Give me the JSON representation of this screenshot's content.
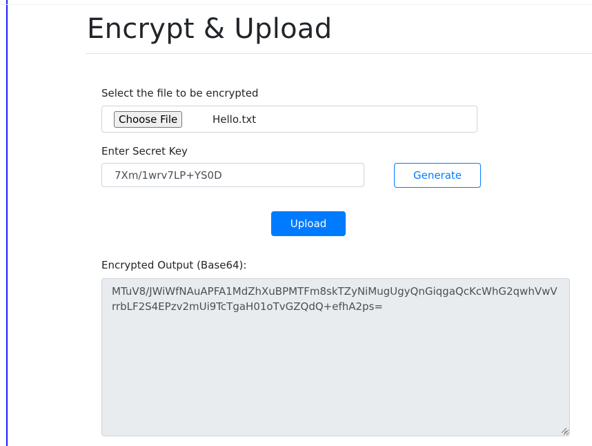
{
  "page": {
    "title": "Encrypt & Upload"
  },
  "file_section": {
    "label": "Select the file to be encrypted",
    "choose_button_label": "Choose File",
    "selected_file": "Hello.txt"
  },
  "key_section": {
    "label": "Enter Secret Key",
    "value": "7Xm/1wrv7LP+YS0D",
    "generate_label": "Generate"
  },
  "upload": {
    "label": "Upload"
  },
  "output": {
    "label": "Encrypted Output (Base64):",
    "value": "MTuV8/JWiWfNAuAPFA1MdZhXuBPMTFm8skTZyNiMugUgyQnGiqgaQcKcWhG2qwhVwVrrbLF2S4EPzv2mUi9TcTgaH01oTvGZQdQ+efhA2ps="
  },
  "colors": {
    "primary": "#007bff",
    "readonly_bg": "#e9ecef",
    "border": "#ced4da",
    "left_frame": "#1a1aff"
  },
  "icons": {
    "resize_grip": "resize-grip-icon"
  }
}
